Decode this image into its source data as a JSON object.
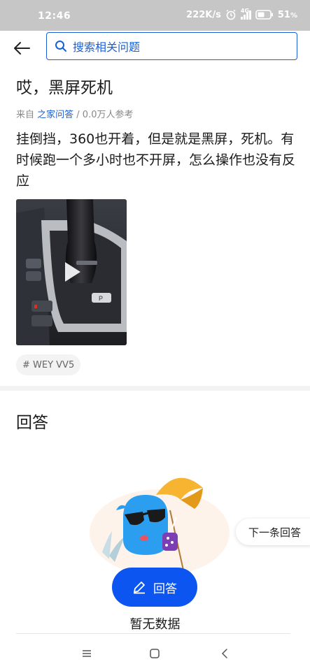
{
  "status_bar": {
    "time": "12:46",
    "net_speed": "222K/s",
    "network": "4G",
    "battery": "51"
  },
  "header": {
    "search_placeholder": "搜索相关问题"
  },
  "question": {
    "title": "哎，黑屏死机",
    "meta_prefix": "来自 ",
    "meta_source": "之家问答",
    "meta_suffix": " / 0.0万人参考",
    "body": "挂倒挡，360也开着，但是就是黑屏，死机。有时候跑一个多小时也不开屏，怎么操作也没有反应",
    "tag": "# WEY VV5"
  },
  "answers": {
    "title": "回答",
    "empty_text": "暂无数据",
    "answer_button": "回答",
    "next_button": "下一条回答"
  },
  "colors": {
    "accent": "#0d55f0",
    "link": "#1a5fd6"
  }
}
